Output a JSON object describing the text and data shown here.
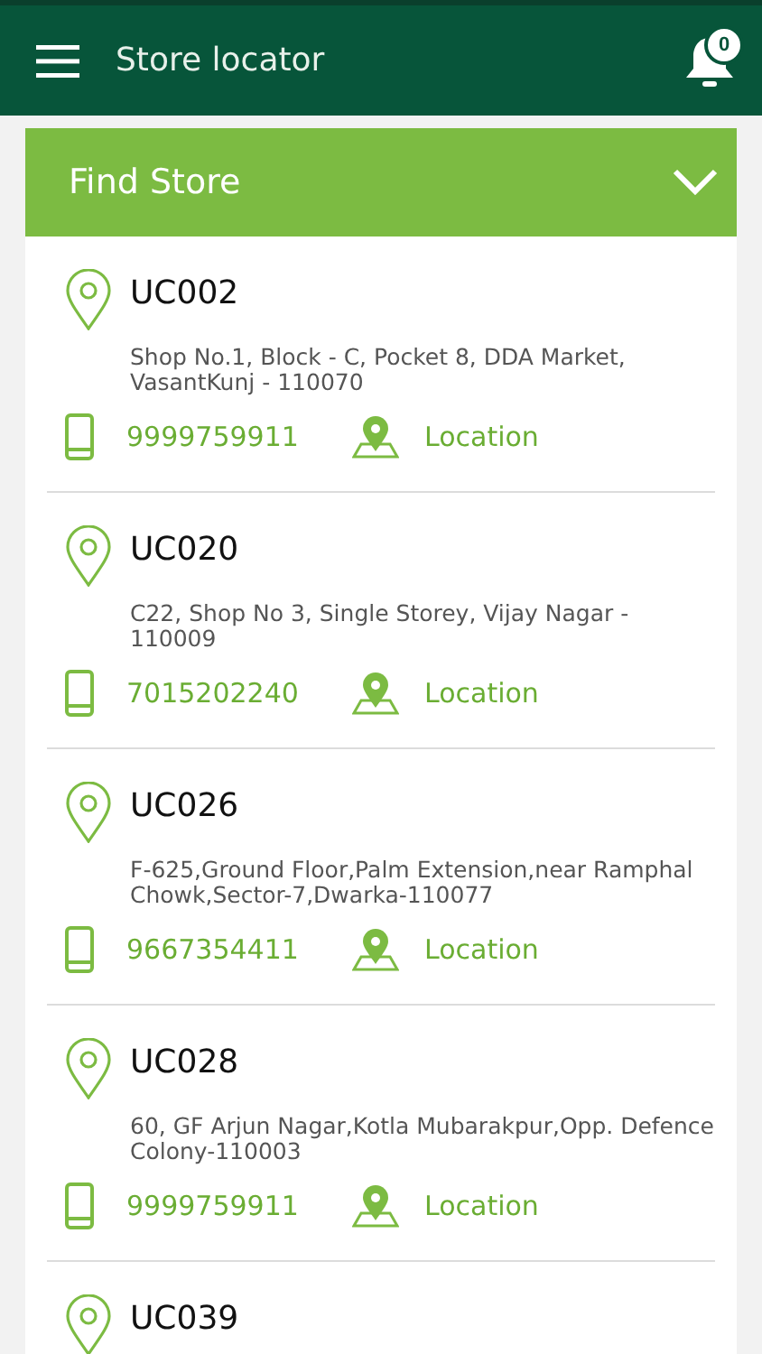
{
  "app_bar": {
    "title": "Store locator",
    "notification_count": "0"
  },
  "finder": {
    "title": "Find Store",
    "expanded": false
  },
  "stores": [
    {
      "code": "UC002",
      "address": "Shop No.1, Block - C, Pocket 8, DDA Market, VasantKunj - 110070",
      "phone": "9999759911",
      "location_label": "Location"
    },
    {
      "code": "UC020",
      "address": "C22, Shop No 3, Single Storey, Vijay Nagar - 110009",
      "phone": "7015202240",
      "location_label": "Location"
    },
    {
      "code": "UC026",
      "address": "F-625,Ground Floor,Palm Extension,near Ramphal Chowk,Sector-7,Dwarka-110077",
      "phone": "9667354411",
      "location_label": "Location"
    },
    {
      "code": "UC028",
      "address": "60, GF Arjun Nagar,Kotla Mubarakpur,Opp. Defence Colony-110003",
      "phone": "9999759911",
      "location_label": "Location"
    },
    {
      "code": "UC039"
    }
  ]
}
